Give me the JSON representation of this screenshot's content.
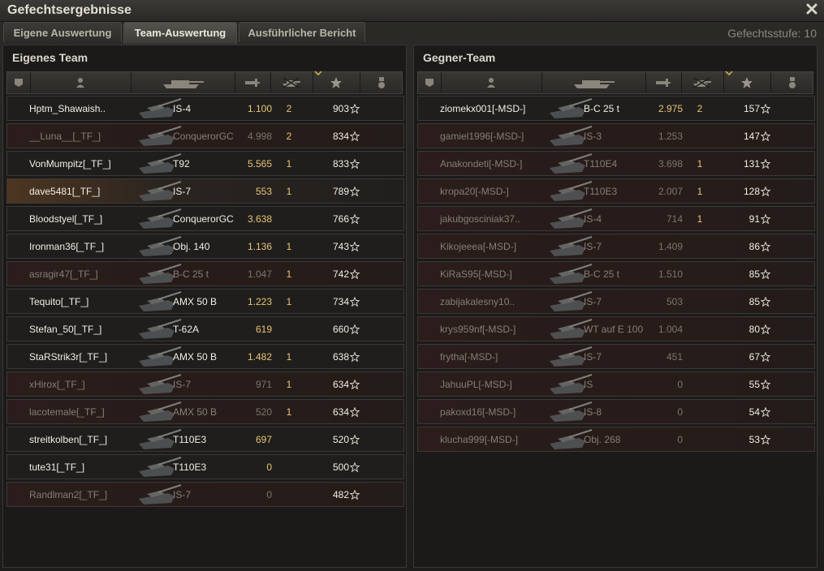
{
  "window": {
    "title": "Gefechtsergebnisse",
    "close_icon": "close-icon"
  },
  "tabs": [
    {
      "label": "Eigene Auswertung",
      "active": false
    },
    {
      "label": "Team-Auswertung",
      "active": true
    },
    {
      "label": "Ausführlicher Bericht",
      "active": false
    }
  ],
  "battle_tier": "Gefechtsstufe: 10",
  "header_icons": [
    "platoon-icon",
    "player-icon",
    "tank-icon",
    "damage-icon",
    "kills-icon",
    "experience-star-icon",
    "medal-icon"
  ],
  "left_team": {
    "title": "Eigenes Team",
    "rows": [
      {
        "name": "Hptm_Shawaish..",
        "vehicle": "IS-4",
        "damage": "1.100",
        "kills": "2",
        "xp": "903",
        "state": "alive"
      },
      {
        "name": "__Luna__[_TF_]",
        "vehicle": "ConquerorGC",
        "damage": "4.998",
        "kills": "2",
        "xp": "834",
        "state": "dead"
      },
      {
        "name": "VonMumpitz[_TF_]",
        "vehicle": "T92",
        "damage": "5.565",
        "kills": "1",
        "xp": "833",
        "state": "alive"
      },
      {
        "name": "dave5481[_TF_]",
        "vehicle": "IS-7",
        "damage": "553",
        "kills": "1",
        "xp": "789",
        "state": "self"
      },
      {
        "name": "Bloodstyel[_TF_]",
        "vehicle": "ConquerorGC",
        "damage": "3.638",
        "kills": "",
        "xp": "766",
        "state": "alive"
      },
      {
        "name": "Ironman36[_TF_]",
        "vehicle": "Obj. 140",
        "damage": "1.136",
        "kills": "1",
        "xp": "743",
        "state": "alive"
      },
      {
        "name": "asragir47[_TF_]",
        "vehicle": "B-C 25 t",
        "damage": "1.047",
        "kills": "1",
        "xp": "742",
        "state": "dead"
      },
      {
        "name": "Tequito[_TF_]",
        "vehicle": "AMX 50 B",
        "damage": "1.223",
        "kills": "1",
        "xp": "734",
        "state": "alive"
      },
      {
        "name": "Stefan_50[_TF_]",
        "vehicle": "T-62A",
        "damage": "619",
        "kills": "",
        "xp": "660",
        "state": "alive"
      },
      {
        "name": "StaRStrik3r[_TF_]",
        "vehicle": "AMX 50 B",
        "damage": "1.482",
        "kills": "1",
        "xp": "638",
        "state": "alive"
      },
      {
        "name": "xHirox[_TF_]",
        "vehicle": "IS-7",
        "damage": "971",
        "kills": "1",
        "xp": "634",
        "state": "dead"
      },
      {
        "name": "lacotemale[_TF_]",
        "vehicle": "AMX 50 B",
        "damage": "520",
        "kills": "1",
        "xp": "634",
        "state": "dead"
      },
      {
        "name": "streitkolben[_TF_]",
        "vehicle": "T110E3",
        "damage": "697",
        "kills": "",
        "xp": "520",
        "state": "alive"
      },
      {
        "name": "tute31[_TF_]",
        "vehicle": "T110E3",
        "damage": "0",
        "kills": "",
        "xp": "500",
        "state": "alive"
      },
      {
        "name": "Randlman2[_TF_]",
        "vehicle": "IS-7",
        "damage": "0",
        "kills": "",
        "xp": "482",
        "state": "dead"
      }
    ]
  },
  "right_team": {
    "title": "Gegner-Team",
    "rows": [
      {
        "name": "ziomekx001[-MSD-]",
        "vehicle": "B-C 25 t",
        "damage": "2.975",
        "kills": "2",
        "xp": "157",
        "state": "alive"
      },
      {
        "name": "gamiel1996[-MSD-]",
        "vehicle": "IS-3",
        "damage": "1.253",
        "kills": "",
        "xp": "147",
        "state": "dead"
      },
      {
        "name": "Anakondeti[-MSD-]",
        "vehicle": "T110E4",
        "damage": "3.698",
        "kills": "1",
        "xp": "131",
        "state": "dead"
      },
      {
        "name": "kropa20[-MSD-]",
        "vehicle": "T110E3",
        "damage": "2.007",
        "kills": "1",
        "xp": "128",
        "state": "dead"
      },
      {
        "name": "jakubgosciniak37..",
        "vehicle": "IS-4",
        "damage": "714",
        "kills": "1",
        "xp": "91",
        "state": "dead"
      },
      {
        "name": "Kikojeeea[-MSD-]",
        "vehicle": "IS-7",
        "damage": "1.409",
        "kills": "",
        "xp": "86",
        "state": "dead"
      },
      {
        "name": "KiRaS95[-MSD-]",
        "vehicle": "B-C 25 t",
        "damage": "1.510",
        "kills": "",
        "xp": "85",
        "state": "dead"
      },
      {
        "name": "zabijakalesny10..",
        "vehicle": "IS-7",
        "damage": "503",
        "kills": "",
        "xp": "85",
        "state": "dead"
      },
      {
        "name": "krys959nf[-MSD-]",
        "vehicle": "WT auf E 100",
        "damage": "1.004",
        "kills": "",
        "xp": "80",
        "state": "dead"
      },
      {
        "name": "frytha[-MSD-]",
        "vehicle": "IS-7",
        "damage": "451",
        "kills": "",
        "xp": "67",
        "state": "dead"
      },
      {
        "name": "JahuuPL[-MSD-]",
        "vehicle": "IS",
        "damage": "0",
        "kills": "",
        "xp": "55",
        "state": "dead"
      },
      {
        "name": "pakoxd16[-MSD-]",
        "vehicle": "IS-8",
        "damage": "0",
        "kills": "",
        "xp": "54",
        "state": "dead"
      },
      {
        "name": "klucha999[-MSD-]",
        "vehicle": "Obj. 268",
        "damage": "0",
        "kills": "",
        "xp": "53",
        "state": "dead"
      }
    ]
  },
  "colors": {
    "damage": "#e8c477",
    "dead_row": "#2a1d1b",
    "self_row": "#4d3621"
  }
}
